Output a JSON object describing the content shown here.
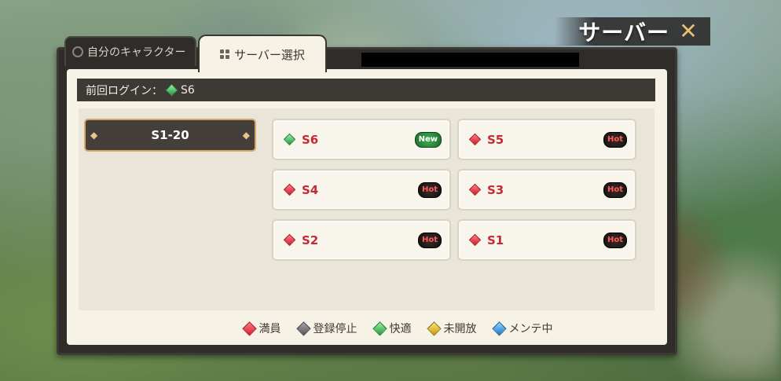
{
  "header": {
    "title": "サーバー"
  },
  "tabs": [
    {
      "label": "自分のキャラクター"
    },
    {
      "label": "サーバー選択"
    }
  ],
  "last_login": {
    "label": "前回ログイン：",
    "server": "S6"
  },
  "range": {
    "label": "S1-20"
  },
  "servers": [
    {
      "name": "S6",
      "status": "green",
      "badge": "New"
    },
    {
      "name": "S5",
      "status": "red",
      "badge": "Hot"
    },
    {
      "name": "S4",
      "status": "red",
      "badge": "Hot"
    },
    {
      "name": "S3",
      "status": "red",
      "badge": "Hot"
    },
    {
      "name": "S2",
      "status": "red",
      "badge": "Hot"
    },
    {
      "name": "S1",
      "status": "red",
      "badge": "Hot"
    }
  ],
  "legend": [
    {
      "label": "満員",
      "color": "red"
    },
    {
      "label": "登録停止",
      "color": "gray"
    },
    {
      "label": "快適",
      "color": "green"
    },
    {
      "label": "未開放",
      "color": "yellow"
    },
    {
      "label": "メンテ中",
      "color": "blue"
    }
  ]
}
